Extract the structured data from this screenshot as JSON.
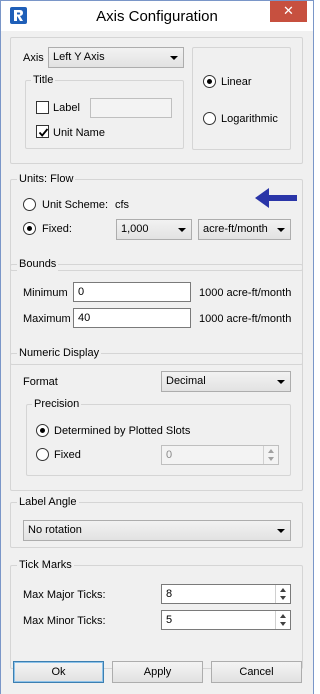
{
  "window": {
    "title": "Axis Configuration",
    "close_glyph": "✕",
    "app_icon": "app-logo-icon"
  },
  "axis_section": {
    "axis_label": "Axis",
    "axis_value": "Left Y Axis",
    "title_group": "Title",
    "label_checkbox": {
      "label": "Label",
      "checked": false
    },
    "label_input": "",
    "unit_name_checkbox": {
      "label": "Unit Name",
      "checked": true
    },
    "scale": {
      "linear": {
        "label": "Linear",
        "selected": true
      },
      "logarithmic": {
        "label": "Logarithmic",
        "selected": false
      }
    }
  },
  "units": {
    "title": "Units: Flow",
    "unit_scheme": {
      "label": "Unit Scheme:",
      "value": "cfs",
      "selected": false
    },
    "fixed": {
      "label": "Fixed:",
      "selected": true
    },
    "multiplier": "1,000",
    "unit": "acre-ft/month",
    "indicator_color": "#2a35a8"
  },
  "bounds": {
    "title": "Bounds",
    "minimum": {
      "label": "Minimum",
      "value": "0",
      "unit": "1000 acre-ft/month"
    },
    "maximum": {
      "label": "Maximum",
      "value": "40",
      "unit": "1000 acre-ft/month"
    }
  },
  "numeric_display": {
    "title": "Numeric Display",
    "format_label": "Format",
    "format_value": "Decimal",
    "precision": {
      "title": "Precision",
      "determined": {
        "label": "Determined by Plotted Slots",
        "selected": true
      },
      "fixed": {
        "label": "Fixed",
        "selected": false
      },
      "fixed_value": "0"
    }
  },
  "label_angle": {
    "title": "Label Angle",
    "value": "No rotation"
  },
  "tick_marks": {
    "title": "Tick Marks",
    "max_major": {
      "label": "Max Major Ticks:",
      "value": "8"
    },
    "max_minor": {
      "label": "Max Minor Ticks:",
      "value": "5"
    }
  },
  "buttons": {
    "ok": "Ok",
    "apply": "Apply",
    "cancel": "Cancel"
  }
}
